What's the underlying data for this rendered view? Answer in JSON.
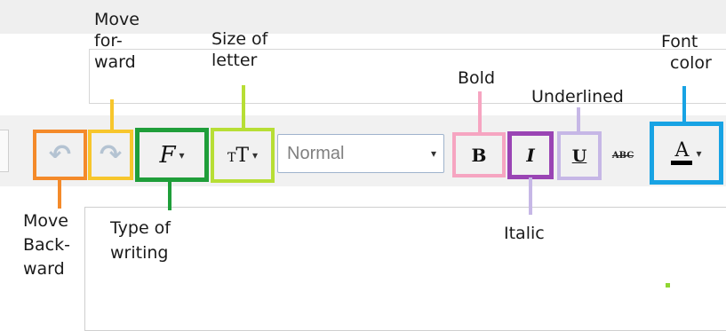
{
  "toolbar": {
    "format_select_value": "Normal",
    "icons": {
      "undo": "undo-arrow-icon",
      "redo": "redo-arrow-icon",
      "font": "font-family-icon",
      "size": "font-size-icon",
      "bold": "bold-icon",
      "italic": "italic-icon",
      "underline": "underline-icon",
      "strikethrough": "strikethrough-icon",
      "font_color": "font-color-icon"
    },
    "glyphs": {
      "font": "F",
      "size_small": "T",
      "size_large": "T",
      "bold": "B",
      "italic": "I",
      "underline": "U",
      "strikethrough": "ABC",
      "font_color": "A",
      "dropdown_arrow": "▾",
      "undo": "↶",
      "redo": "↶"
    }
  },
  "annotations": {
    "move_forward": [
      "Move",
      "for-",
      "ward"
    ],
    "size_of_letter": [
      "Size of",
      "letter"
    ],
    "bold": [
      "Bold"
    ],
    "underlined": [
      "Underlined"
    ],
    "font_color": [
      "Font",
      "color"
    ],
    "move_backward": [
      "Move",
      "Back-",
      "ward"
    ],
    "type_of_writing": [
      "Type of",
      "writing"
    ],
    "italic": [
      "Italic"
    ]
  },
  "colors": {
    "undo_frame": "#f48a2a",
    "redo_frame": "#f7c62c",
    "font_frame": "#1f9e3a",
    "size_frame": "#b7de35",
    "bold_frame": "#f6a5c1",
    "italic_frame": "#9a44b4",
    "underline_frame": "#c6b7e6",
    "color_frame": "#18a3e4"
  }
}
